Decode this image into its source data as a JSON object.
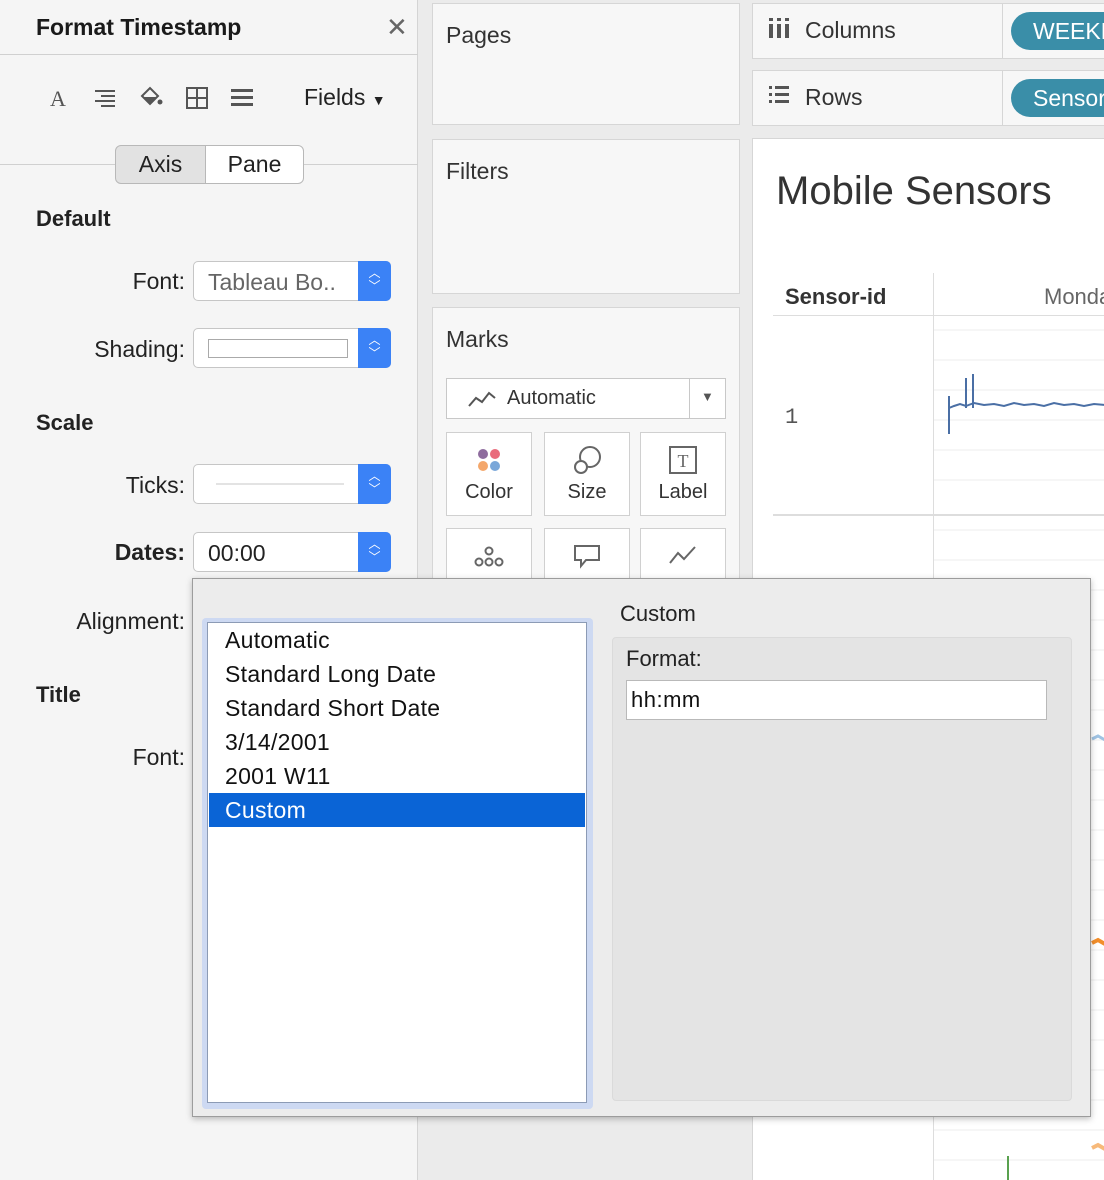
{
  "format_pane": {
    "title": "Format Timestamp",
    "fields_label": "Fields",
    "tabs": [
      {
        "label": "Axis",
        "active": true
      },
      {
        "label": "Pane",
        "active": false
      }
    ],
    "default_heading": "Default",
    "font_label": "Font:",
    "font_value": "Tableau Bo..",
    "shading_label": "Shading:",
    "scale_heading": "Scale",
    "ticks_label": "Ticks:",
    "dates_label": "Dates:",
    "dates_value": "00:00",
    "alignment_label": "Alignment:",
    "title_heading": "Title",
    "title_font_label": "Font:"
  },
  "shelves": {
    "pages": "Pages",
    "filters": "Filters",
    "marks": "Marks",
    "mark_type": "Automatic",
    "mark_buttons": [
      {
        "label": "Color",
        "icon": "color-dots-icon"
      },
      {
        "label": "Size",
        "icon": "size-circles-icon"
      },
      {
        "label": "Label",
        "icon": "label-text-icon"
      }
    ],
    "mark_buttons_row2_icons": [
      "detail-dots-icon",
      "tooltip-speech-icon",
      "path-line-icon"
    ]
  },
  "viz": {
    "columns_label": "Columns",
    "columns_pill": "WEEKDAY",
    "rows_label": "Rows",
    "rows_pill": "Sensor-id",
    "title": "Mobile Sensors",
    "header_sensor": "Sensor-id",
    "header_day": "Monday",
    "row_value": "1",
    "colors": {
      "pill": "#3a8ea8",
      "line_blue": "#4a6fa5",
      "line_light": "#9fc3e3",
      "line_orange": "#f28e2b",
      "line_peach": "#f7b97a",
      "line_green": "#59a14f"
    }
  },
  "popup": {
    "list_items": [
      "Automatic",
      "Standard Long Date",
      "Standard Short Date",
      "3/14/2001",
      "2001 W11",
      "Custom"
    ],
    "selected_index": 5,
    "custom_heading": "Custom",
    "format_label": "Format:",
    "format_value": "hh:mm",
    "selection_color": "#0a64d6"
  }
}
